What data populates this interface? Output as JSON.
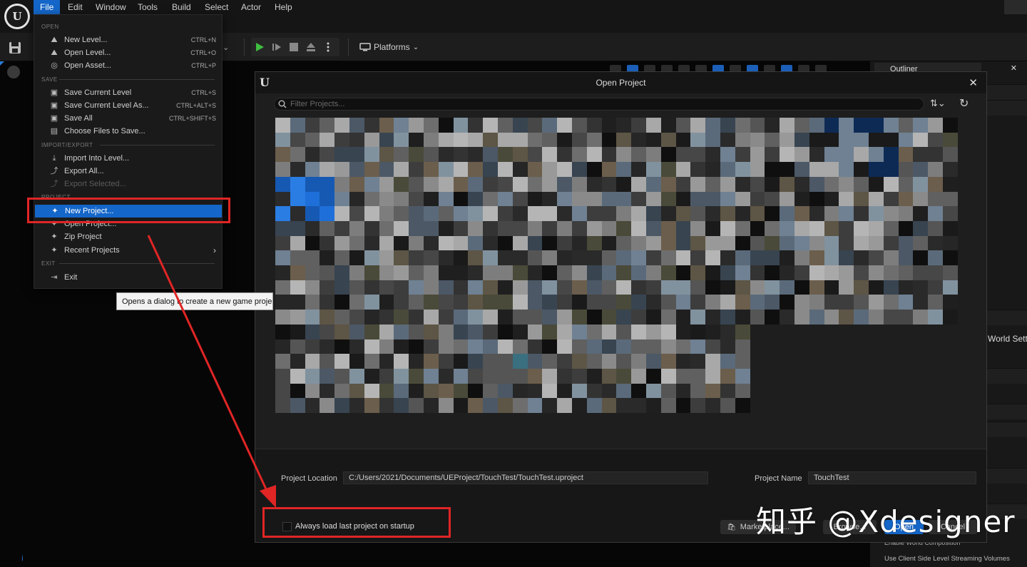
{
  "menubar": {
    "items": [
      "File",
      "Edit",
      "Window",
      "Tools",
      "Build",
      "Select",
      "Actor",
      "Help"
    ],
    "active": "File"
  },
  "toolbar": {
    "platforms_label": "Platforms"
  },
  "file_menu": {
    "sections": {
      "open": "OPEN",
      "save": "SAVE",
      "import_export": "IMPORT/EXPORT",
      "project": "PROJECT",
      "exit": "EXIT"
    },
    "items": [
      {
        "label": "New Level...",
        "shortcut": "CTRL+N"
      },
      {
        "label": "Open Level...",
        "shortcut": "CTRL+O"
      },
      {
        "label": "Open Asset...",
        "shortcut": "CTRL+P"
      },
      {
        "label": "Save Current Level",
        "shortcut": "CTRL+S"
      },
      {
        "label": "Save Current Level As...",
        "shortcut": "CTRL+ALT+S"
      },
      {
        "label": "Save All",
        "shortcut": "CTRL+SHIFT+S"
      },
      {
        "label": "Choose Files to Save...",
        "shortcut": ""
      },
      {
        "label": "Import Into Level...",
        "shortcut": ""
      },
      {
        "label": "Export All...",
        "shortcut": ""
      },
      {
        "label": "Export Selected...",
        "shortcut": ""
      },
      {
        "label": "New Project...",
        "shortcut": ""
      },
      {
        "label": "Open Project...",
        "shortcut": ""
      },
      {
        "label": "Zip Project",
        "shortcut": ""
      },
      {
        "label": "Recent Projects",
        "shortcut": ""
      },
      {
        "label": "Exit",
        "shortcut": ""
      }
    ]
  },
  "tooltip": "Opens a dialog to create a new game project",
  "right_panel": {
    "outliner": "Outliner",
    "world_settings": "World Setti",
    "row1": "Enable World Composition",
    "row2": "Use Client Side Level Streaming Volumes"
  },
  "dialog": {
    "title": "Open Project",
    "search_placeholder": "Filter Projects...",
    "project_location_label": "Project Location",
    "project_location_value": "C:/Users/2021/Documents/UEProject/TouchTest/TouchTest.uproject",
    "project_name_label": "Project Name",
    "project_name_value": "TouchTest",
    "always_load_label": "Always load last project on startup",
    "always_load_checked": false,
    "buttons": {
      "marketplace": "Marketplace...",
      "browse": "Browse...",
      "open": "Open",
      "cancel": "Cancel"
    }
  },
  "watermark": "知乎 @Xdesigner",
  "colors": {
    "accent": "#1466c8",
    "annotation": "#e02525"
  }
}
